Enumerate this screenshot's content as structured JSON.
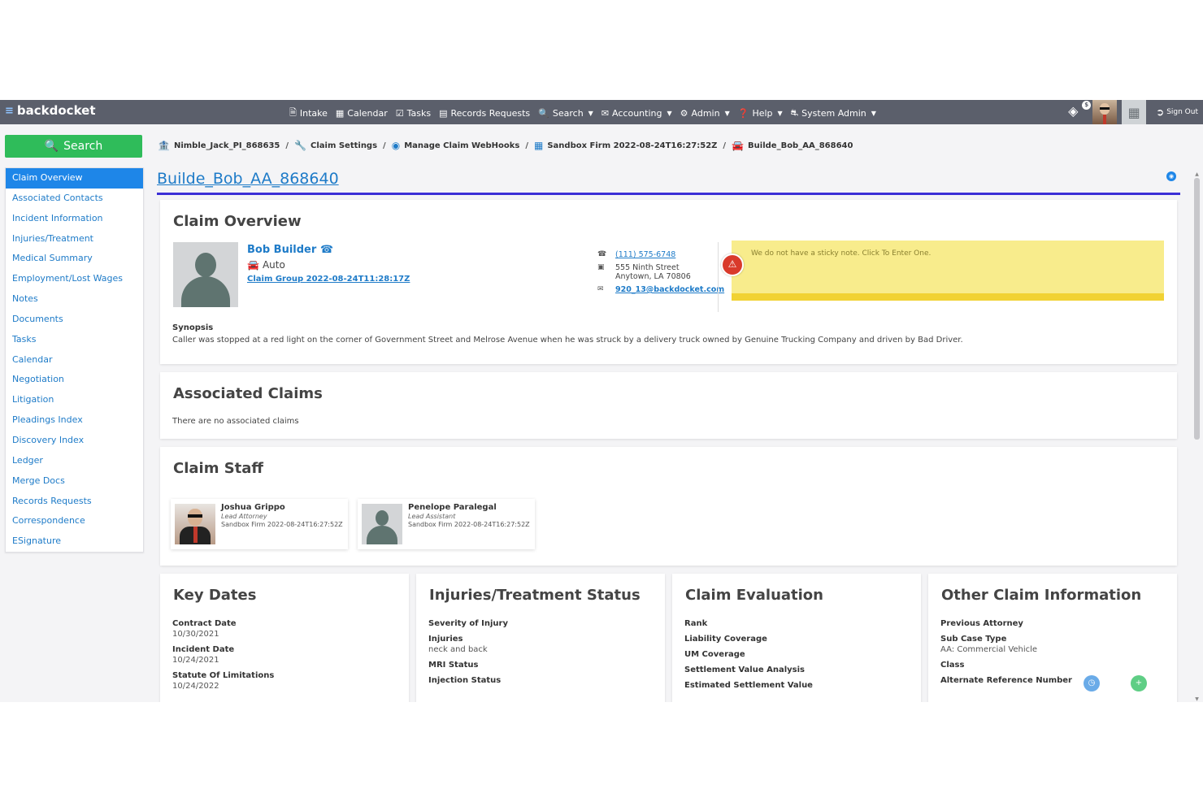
{
  "app": {
    "brand": "backdocket"
  },
  "nav": {
    "items": [
      {
        "label": "Intake",
        "icon": "document-icon"
      },
      {
        "label": "Calendar",
        "icon": "calendar-icon"
      },
      {
        "label": "Tasks",
        "icon": "tasks-icon"
      },
      {
        "label": "Records Requests",
        "icon": "records-icon"
      },
      {
        "label": "Search",
        "icon": "search-icon",
        "dropdown": true
      },
      {
        "label": "Accounting",
        "icon": "accounting-icon",
        "dropdown": true
      },
      {
        "label": "Admin",
        "icon": "gear-icon",
        "dropdown": true
      },
      {
        "label": "Help",
        "icon": "help-icon",
        "dropdown": true
      },
      {
        "label": "System Admin",
        "icon": "sysadmin-icon",
        "dropdown": true
      }
    ],
    "piggy_badge": "$",
    "signout": "Sign Out"
  },
  "sidebar": {
    "search_label": "Search",
    "items": [
      {
        "label": "Claim Overview",
        "active": true
      },
      {
        "label": "Associated Contacts"
      },
      {
        "label": "Incident Information"
      },
      {
        "label": "Injuries/Treatment"
      },
      {
        "label": "Medical Summary"
      },
      {
        "label": "Employment/Lost Wages"
      },
      {
        "label": "Notes"
      },
      {
        "label": "Documents"
      },
      {
        "label": "Tasks"
      },
      {
        "label": "Calendar"
      },
      {
        "label": "Negotiation"
      },
      {
        "label": "Litigation"
      },
      {
        "label": "Pleadings Index"
      },
      {
        "label": "Discovery Index"
      },
      {
        "label": "Ledger"
      },
      {
        "label": "Merge Docs"
      },
      {
        "label": "Records Requests"
      },
      {
        "label": "Correspondence"
      },
      {
        "label": "ESignature"
      }
    ]
  },
  "breadcrumb": [
    {
      "label": "Nimble_Jack_PI_868635",
      "icon": "bank-icon"
    },
    {
      "label": "Claim Settings",
      "icon": "wrench-icon"
    },
    {
      "label": "Manage Claim WebHooks",
      "icon": "rss-icon"
    },
    {
      "label": "Sandbox Firm 2022-08-24T16:27:52Z",
      "icon": "building-icon"
    },
    {
      "label": "Builde_Bob_AA_868640",
      "icon": "car-icon"
    }
  ],
  "claim": {
    "title": "Builde_Bob_AA_868640"
  },
  "overview": {
    "heading": "Claim Overview",
    "client_name": "Bob Builder",
    "client_type": "Auto",
    "claim_group": "Claim Group 2022-08-24T11:28:17Z",
    "phone": "(111) 575-6748",
    "address_line1": "555 Ninth Street",
    "address_line2": "Anytown, LA 70806",
    "email": "920_13@backdocket.com",
    "sticky_note": "We do not have a sticky note. Click To Enter One.",
    "synopsis_label": "Synopsis",
    "synopsis": "Caller was stopped at a red light on the corner of Government Street and Melrose Avenue when he was struck by a delivery truck owned by Genuine Trucking Company and driven by Bad Driver."
  },
  "associated_claims": {
    "heading": "Associated Claims",
    "empty_text": "There are no associated claims"
  },
  "staff": {
    "heading": "Claim Staff",
    "members": [
      {
        "name": "Joshua Grippo",
        "role": "Lead Attorney",
        "firm": "Sandbox Firm 2022-08-24T16:27:52Z"
      },
      {
        "name": "Penelope Paralegal",
        "role": "Lead Assistant",
        "firm": "Sandbox Firm 2022-08-24T16:27:52Z"
      }
    ]
  },
  "key_dates": {
    "heading": "Key Dates",
    "fields": [
      {
        "label": "Contract Date",
        "value": "10/30/2021"
      },
      {
        "label": "Incident Date",
        "value": "10/24/2021"
      },
      {
        "label": "Statute Of Limitations",
        "value": "10/24/2022"
      }
    ]
  },
  "injuries_status": {
    "heading": "Injuries/Treatment Status",
    "fields": [
      {
        "label": "Severity of Injury",
        "value": ""
      },
      {
        "label": "Injuries",
        "value": "neck and back"
      },
      {
        "label": "MRI Status",
        "value": ""
      },
      {
        "label": "Injection Status",
        "value": ""
      }
    ]
  },
  "claim_evaluation": {
    "heading": "Claim Evaluation",
    "fields": [
      {
        "label": "Rank",
        "value": ""
      },
      {
        "label": "Liability Coverage",
        "value": ""
      },
      {
        "label": "UM Coverage",
        "value": ""
      },
      {
        "label": "Settlement Value Analysis",
        "value": ""
      },
      {
        "label": "Estimated Settlement Value",
        "value": ""
      }
    ]
  },
  "other_info": {
    "heading": "Other Claim Information",
    "fields": [
      {
        "label": "Previous Attorney",
        "value": ""
      },
      {
        "label": "Sub Case Type",
        "value": "AA: Commercial Vehicle"
      },
      {
        "label": "Class",
        "value": ""
      },
      {
        "label": "Alternate Reference Number",
        "value": ""
      }
    ]
  }
}
